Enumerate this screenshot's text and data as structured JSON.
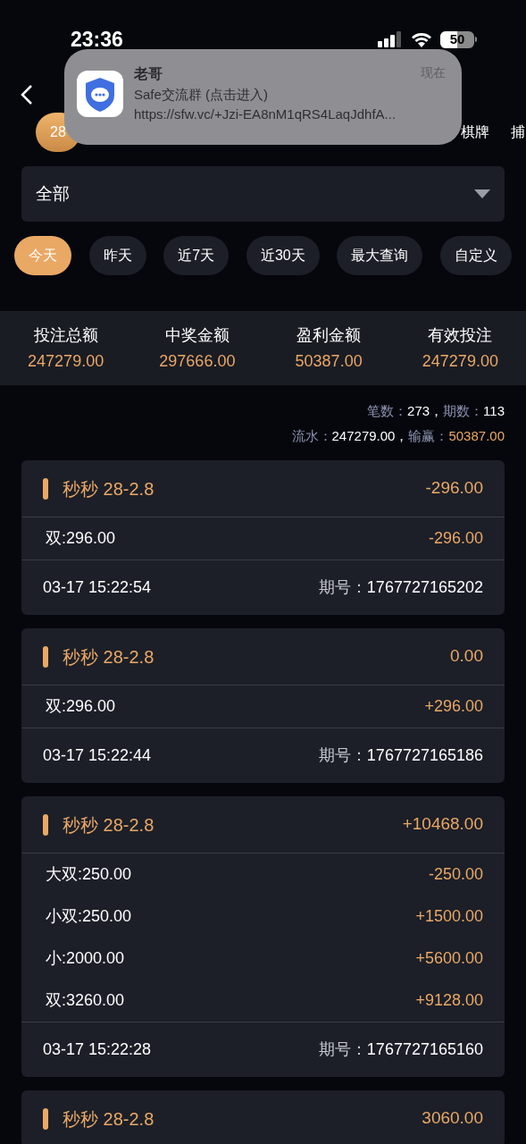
{
  "status_bar": {
    "time": "23:36",
    "battery": "50"
  },
  "notification": {
    "app": "老哥",
    "time": "现在",
    "line_1": "Safe交流群 (点击进入)",
    "line_2": "https://sfw.vc/+Jzi-EA8nM1qRS4LaqJdhfA..."
  },
  "tabs": [
    {
      "label": "28",
      "selected": true
    },
    {
      "label": "棋牌",
      "selected": false
    },
    {
      "label": "捕",
      "selected": false
    }
  ],
  "filter": {
    "value": "全部"
  },
  "date_ranges": [
    {
      "label": "今天",
      "selected": true
    },
    {
      "label": "昨天",
      "selected": false
    },
    {
      "label": "近7天",
      "selected": false
    },
    {
      "label": "近30天",
      "selected": false
    },
    {
      "label": "最大查询",
      "selected": false
    },
    {
      "label": "自定义",
      "selected": false
    }
  ],
  "summary": [
    {
      "label": "投注总额",
      "value": "247279.00"
    },
    {
      "label": "中奖金额",
      "value": "297666.00"
    },
    {
      "label": "盈利金额",
      "value": "50387.00"
    },
    {
      "label": "有效投注",
      "value": "247279.00"
    }
  ],
  "stats": {
    "count_label": "笔数：",
    "count": "273，",
    "periods_label": "期数：",
    "periods": "113",
    "turnover_label": "流水：",
    "turnover": "247279.00，",
    "win_label": "输赢：",
    "win": "50387.00"
  },
  "records": [
    {
      "title": "秒秒 28-2.8",
      "amount": "-296.00",
      "bets": [
        {
          "label": "双:296.00",
          "amount": "-296.00"
        }
      ],
      "time": "03-17 15:22:54",
      "issue_label": "期号：",
      "issue": "1767727165202"
    },
    {
      "title": "秒秒 28-2.8",
      "amount": "0.00",
      "bets": [
        {
          "label": "双:296.00",
          "amount": "+296.00"
        }
      ],
      "time": "03-17 15:22:44",
      "issue_label": "期号：",
      "issue": "1767727165186"
    },
    {
      "title": "秒秒 28-2.8",
      "amount": "+10468.00",
      "bets": [
        {
          "label": "大双:250.00",
          "amount": "-250.00"
        },
        {
          "label": "小双:250.00",
          "amount": "+1500.00"
        },
        {
          "label": "小:2000.00",
          "amount": "+5600.00"
        },
        {
          "label": "双:3260.00",
          "amount": "+9128.00"
        }
      ],
      "time": "03-17 15:22:28",
      "issue_label": "期号：",
      "issue": "1767727165160"
    },
    {
      "title": "秒秒 28-2.8",
      "amount": "3060.00"
    }
  ]
}
